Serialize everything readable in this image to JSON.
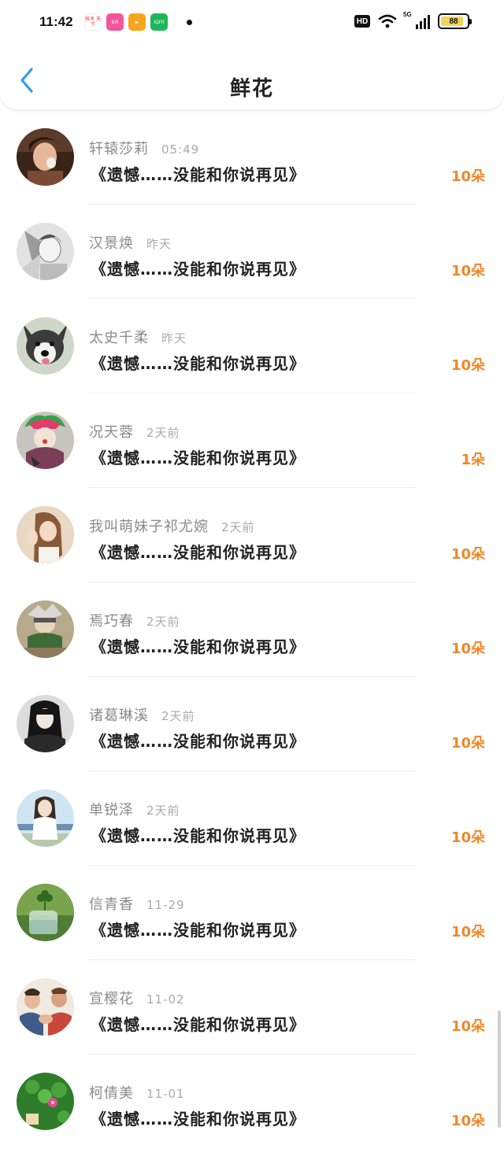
{
  "status_bar": {
    "time": "11:42",
    "apps": [
      {
        "name": "tech-news-app-icon",
        "text": "技术\n天下"
      },
      {
        "name": "bilibili-app-icon",
        "text": "bili"
      },
      {
        "name": "video-app-icon",
        "text": "▶"
      },
      {
        "name": "iqiyi-app-icon",
        "text": "iQIYI"
      }
    ],
    "hd": "HD",
    "network": "5G",
    "battery": "88"
  },
  "header": {
    "title": "鲜花"
  },
  "colors": {
    "accent": "#f0872a",
    "back_arrow": "#2f9de8"
  },
  "items": [
    {
      "name": "轩辕莎莉",
      "time": "05:49",
      "gift": "《遗憾……没能和你说再见》",
      "count": "10朵",
      "avatar": "portrait-woman"
    },
    {
      "name": "汉景焕",
      "time": "昨天",
      "gift": "《遗憾……没能和你说再见》",
      "count": "10朵",
      "avatar": "sketch-character"
    },
    {
      "name": "太史千柔",
      "time": "昨天",
      "gift": "《遗憾……没能和你说再见》",
      "count": "10朵",
      "avatar": "husky-dog"
    },
    {
      "name": "况天蓉",
      "time": "2天前",
      "gift": "《遗憾……没能和你说再见》",
      "count": "1朵",
      "avatar": "costume-character"
    },
    {
      "name": "我叫萌妹子祁尤婉",
      "time": "2天前",
      "gift": "《遗憾……没能和你说再见》",
      "count": "10朵",
      "avatar": "girl-waving"
    },
    {
      "name": "焉巧春",
      "time": "2天前",
      "gift": "《遗憾……没能和你说再见》",
      "count": "10朵",
      "avatar": "anime-character"
    },
    {
      "name": "诸葛琳溪",
      "time": "2天前",
      "gift": "《遗憾……没能和你说再见》",
      "count": "10朵",
      "avatar": "dark-portrait"
    },
    {
      "name": "单锐泽",
      "time": "2天前",
      "gift": "《遗憾……没能和你说再见》",
      "count": "10朵",
      "avatar": "girl-on-bench"
    },
    {
      "name": "信青香",
      "time": "11-29",
      "gift": "《遗憾……没能和你说再见》",
      "count": "10朵",
      "avatar": "clover-jar"
    },
    {
      "name": "宣樱花",
      "time": "11-02",
      "gift": "《遗憾……没能和你说再见》",
      "count": "10朵",
      "avatar": "people-handshake"
    },
    {
      "name": "柯倩美",
      "time": "11-01",
      "gift": "《遗憾……没能和你说再见》",
      "count": "10朵",
      "avatar": "clover-flower"
    }
  ]
}
